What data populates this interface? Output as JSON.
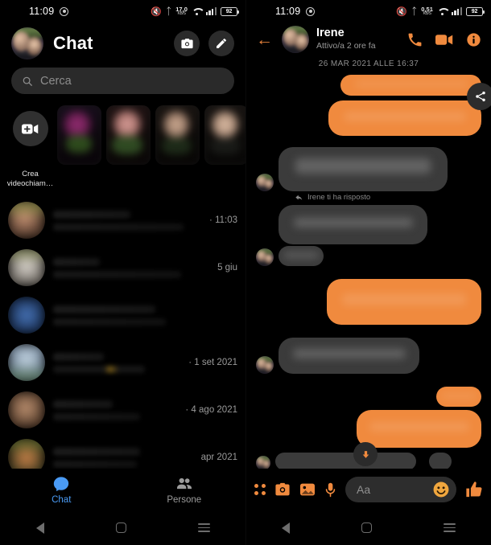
{
  "status_bar": {
    "time": "11:09",
    "icons": [
      "screen-record-icon",
      "mute-icon",
      "bluetooth-icon",
      "network-speed",
      "wifi-icon",
      "signal-icon",
      "battery-icon"
    ],
    "battery": "92",
    "net_speed_left": {
      "value": "17,0",
      "unit": "KB/S"
    },
    "net_speed_right": {
      "value": "0,51",
      "unit": "KB/S"
    }
  },
  "left_pane": {
    "header": {
      "title": "Chat",
      "camera_icon": "camera-icon",
      "compose_icon": "pencil-icon",
      "avatar": "profile-avatar"
    },
    "search": {
      "placeholder": "Cerca",
      "icon": "search-icon"
    },
    "stories": {
      "create": {
        "label": "Crea videochiam…",
        "icon": "video-plus-icon"
      },
      "items": [
        "story-1",
        "story-2",
        "story-3",
        "story-4"
      ]
    },
    "chats": [
      {
        "name": "",
        "preview": "",
        "time": "· 11:03"
      },
      {
        "name": "",
        "preview": "",
        "time": "5 giu"
      },
      {
        "name": "",
        "preview": "",
        "time": ""
      },
      {
        "name": "",
        "preview": "",
        "time": "· 1 set 2021"
      },
      {
        "name": "",
        "preview": "",
        "time": "· 4 ago 2021"
      },
      {
        "name": "",
        "preview": "",
        "time": "apr 2021"
      }
    ],
    "tabs": [
      {
        "label": "Chat",
        "icon": "chat-bubble-icon",
        "active": true
      },
      {
        "label": "Persone",
        "icon": "people-icon",
        "active": false
      }
    ]
  },
  "right_pane": {
    "header": {
      "back_icon": "back-arrow-icon",
      "name": "Irene",
      "status": "Attivo/a 2 ore fa",
      "call_icon": "phone-icon",
      "video_icon": "video-camera-icon",
      "info_icon": "info-icon"
    },
    "conversation_date": "26 MAR 2021 ALLE 16:37",
    "reply_notice": {
      "text": "Irene ti ha risposto",
      "icon": "reply-arrow-icon"
    },
    "share_icon": "share-icon",
    "scroll_down_icon": "chevron-down-icon",
    "messages": [
      {
        "id": "m1",
        "side": "out",
        "text": ""
      },
      {
        "id": "m2",
        "side": "out",
        "text": ""
      },
      {
        "id": "m3",
        "side": "in",
        "text": ""
      },
      {
        "id": "m4",
        "side": "in",
        "text": ""
      },
      {
        "id": "m5",
        "side": "in",
        "text": ""
      },
      {
        "id": "m6",
        "side": "out",
        "text": ""
      },
      {
        "id": "m7",
        "side": "in",
        "text": ""
      },
      {
        "id": "m8",
        "side": "out",
        "text": ""
      },
      {
        "id": "m9",
        "side": "out",
        "text": ""
      }
    ],
    "composer": {
      "placeholder": "Aa",
      "more_icon": "four-dots-icon",
      "camera_icon": "camera-icon",
      "gallery_icon": "gallery-icon",
      "mic_icon": "microphone-icon",
      "emoji_icon": "emoji-smiley-icon",
      "like_icon": "thumbs-up-icon"
    }
  },
  "android_nav": {
    "back": "nav-back-icon",
    "home": "nav-home-icon",
    "recents": "nav-recents-icon"
  },
  "colors": {
    "accent_orange": "#f08a3e",
    "incoming_bubble": "#3b3b3b",
    "background": "#000000",
    "tab_active_blue": "#4a9bf5",
    "search_bg": "#2a2a2a"
  }
}
